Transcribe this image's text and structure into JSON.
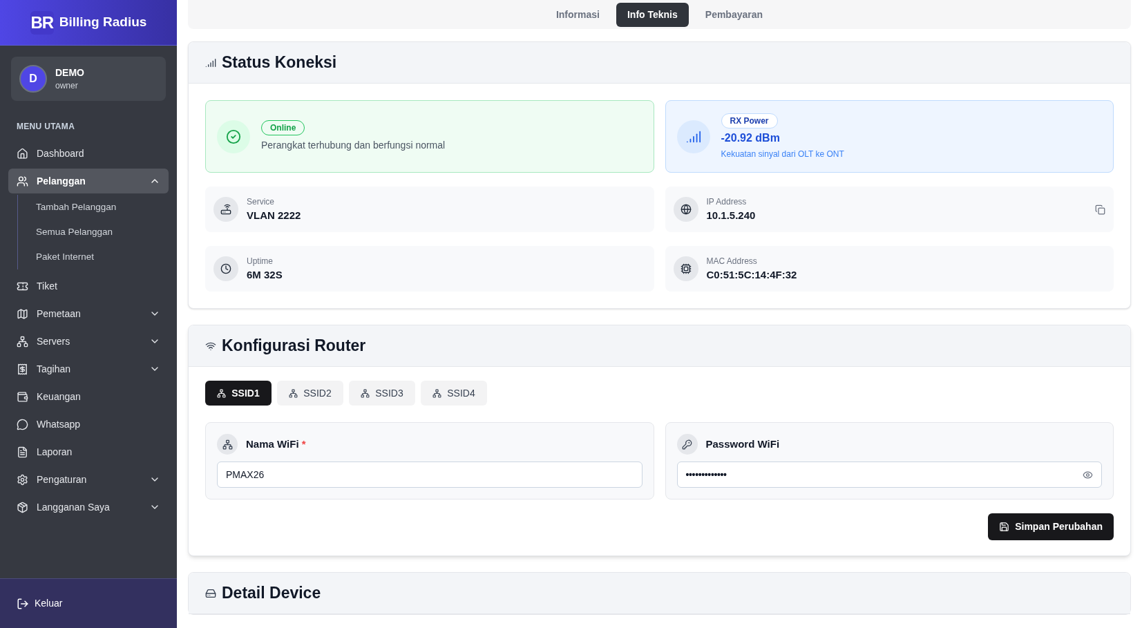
{
  "brand": {
    "logo": "BR",
    "name": "Billing Radius"
  },
  "user": {
    "initial": "D",
    "name": "DEMO",
    "role": "owner"
  },
  "menu_heading": "MENU UTAMA",
  "menu": [
    {
      "label": "Dashboard",
      "selected": false
    },
    {
      "label": "Pelanggan",
      "selected": true,
      "expanded": true,
      "children": [
        {
          "label": "Tambah Pelanggan",
          "selected": false
        },
        {
          "label": "Semua Pelanggan",
          "selected": false
        },
        {
          "label": "Paket Internet",
          "selected": false
        }
      ]
    },
    {
      "label": "Tiket",
      "selected": false
    },
    {
      "label": "Pemetaan",
      "selected": false,
      "expanded": false
    },
    {
      "label": "Servers",
      "selected": false,
      "expanded": false
    },
    {
      "label": "Tagihan",
      "selected": false,
      "expanded": false
    },
    {
      "label": "Keuangan",
      "selected": false
    },
    {
      "label": "Whatsapp",
      "selected": false
    },
    {
      "label": "Laporan",
      "selected": false
    },
    {
      "label": "Pengaturan",
      "selected": false,
      "expanded": false
    },
    {
      "label": "Langganan Saya",
      "selected": false,
      "expanded": false
    }
  ],
  "logout": "Keluar",
  "tabs": [
    {
      "label": "Informasi",
      "selected": false
    },
    {
      "label": "Info Teknis",
      "selected": true
    },
    {
      "label": "Pembayaran",
      "selected": false
    }
  ],
  "status_section": {
    "title": "Status Koneksi",
    "status": {
      "badge": "Online",
      "text": "Perangkat terhubung dan berfungsi normal"
    },
    "rx_power": {
      "badge": "RX Power",
      "value": "-20.92 dBm",
      "text": "Kekuatan sinyal dari OLT ke ONT"
    },
    "details": [
      {
        "label": "Service",
        "value": "VLAN 2222",
        "copyable": false
      },
      {
        "label": "IP Address",
        "value": "10.1.5.240",
        "copyable": true
      },
      {
        "label": "Uptime",
        "value": "6M 32S",
        "copyable": false
      },
      {
        "label": "MAC Address",
        "value": "C0:51:5C:14:4F:32",
        "copyable": false
      }
    ]
  },
  "router_section": {
    "title": "Konfigurasi Router",
    "ssid_tabs": [
      {
        "label": "SSID1",
        "selected": true
      },
      {
        "label": "SSID2",
        "selected": false
      },
      {
        "label": "SSID3",
        "selected": false
      },
      {
        "label": "SSID4",
        "selected": false
      }
    ],
    "fields": [
      {
        "kind": "text",
        "label": "Nama WiFi",
        "required": "*",
        "value": "PMAX26"
      },
      {
        "kind": "password",
        "label": "Password WiFi",
        "value": "•••••••••••••"
      }
    ],
    "save_button": "Simpan Perubahan"
  },
  "device_section": {
    "title": "Detail Device"
  }
}
